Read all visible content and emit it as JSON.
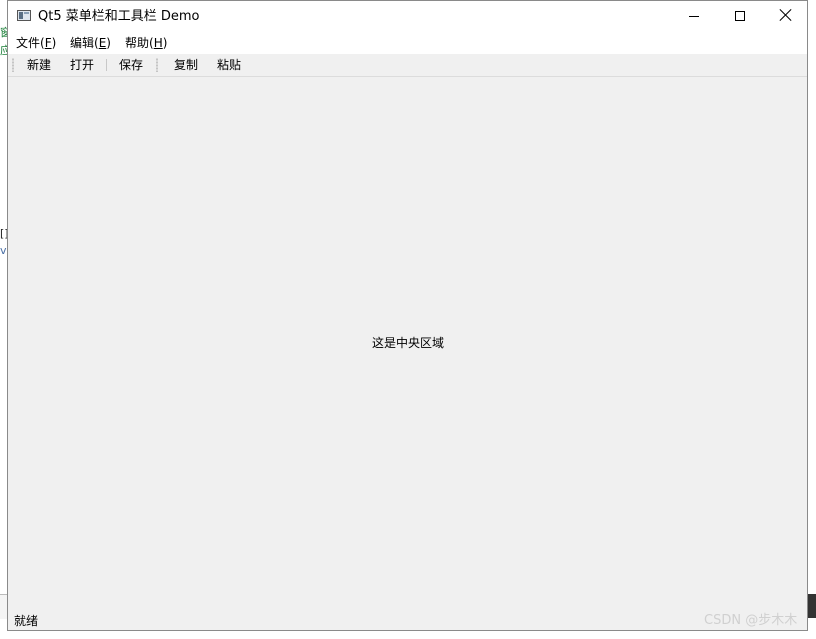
{
  "window": {
    "title": "Qt5 菜单栏和工具栏 Demo"
  },
  "menubar": {
    "file_prefix": "文件(",
    "file_key": "F",
    "file_suffix": ")",
    "edit_prefix": "编辑(",
    "edit_key": "E",
    "edit_suffix": ")",
    "help_prefix": "帮助(",
    "help_key": "H",
    "help_suffix": ")"
  },
  "toolbar": {
    "new_label": "新建",
    "open_label": "打开",
    "save_label": "保存",
    "copy_label": "复制",
    "paste_label": "粘贴"
  },
  "central": {
    "label": "这是中央区域"
  },
  "statusbar": {
    "message": "就绪"
  },
  "watermark": {
    "text": "CSDN @步木木"
  },
  "background": {
    "glyph_1": "窗",
    "glyph_2": "应",
    "glyph_3": "[]",
    "glyph_4": "v"
  }
}
